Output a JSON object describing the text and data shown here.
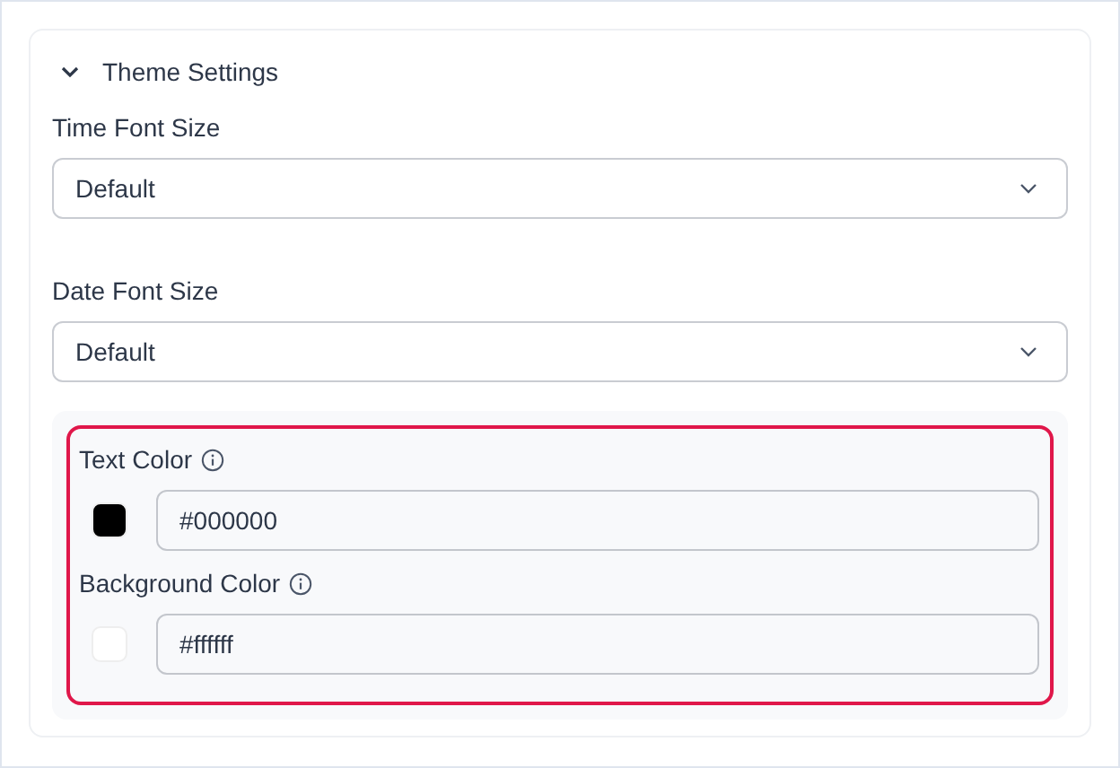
{
  "section": {
    "title": "Theme Settings",
    "expanded": true
  },
  "selects": [
    {
      "label": "Time Font Size",
      "value": "Default"
    },
    {
      "label": "Date Font Size",
      "value": "Default"
    }
  ],
  "colors": [
    {
      "label": "Text Color",
      "color": "#000000",
      "value": "#000000"
    },
    {
      "label": "Background Color",
      "color": "#ffffff",
      "value": "#ffffff"
    }
  ]
}
